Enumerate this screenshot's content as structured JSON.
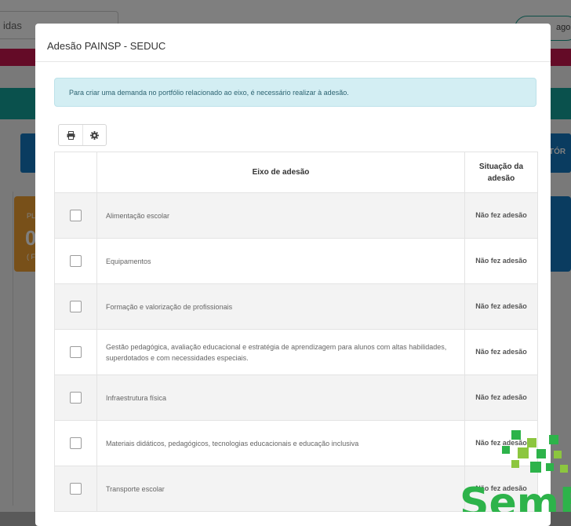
{
  "background": {
    "search_text": "idas",
    "right_pill_text": "ago",
    "right_button_text": "TÓR",
    "orange_card_top": "PL",
    "orange_card_value": "0",
    "orange_card_bottom": "( F"
  },
  "modal": {
    "title": "Adesão PAINSP - SEDUC",
    "alert": "Para criar uma demanda no portfólio relacionado ao eixo, é necessário realizar à adesão.",
    "toolbar": {
      "print_icon": "print-icon",
      "settings_icon": "gear-icon"
    },
    "table": {
      "columns": [
        "",
        "Eixo de adesão",
        "Situação da adesão"
      ],
      "rows": [
        {
          "eixo": "Alimentação escolar",
          "situacao": "Não fez adesão"
        },
        {
          "eixo": "Equipamentos",
          "situacao": "Não fez adesão"
        },
        {
          "eixo": "Formação e valorização de profissionais",
          "situacao": "Não fez adesão"
        },
        {
          "eixo": "Gestão pedagógica, avaliação educacional e estratégia de aprendizagem para alunos com altas habilidades, superdotados e com necessidades especiais.",
          "situacao": "Não fez adesão"
        },
        {
          "eixo": "Infraestrutura física",
          "situacao": "Não fez adesão"
        },
        {
          "eixo": "Materiais didáticos, pedagógicos, tecnologias educacionais e educação inclusiva",
          "situacao": "Não fez adesão"
        },
        {
          "eixo": "Transporte escolar",
          "situacao": "Não fez adesão"
        }
      ]
    }
  },
  "watermark": {
    "text": "SemE",
    "colors": [
      "#2db34a",
      "#8cc63f"
    ]
  }
}
